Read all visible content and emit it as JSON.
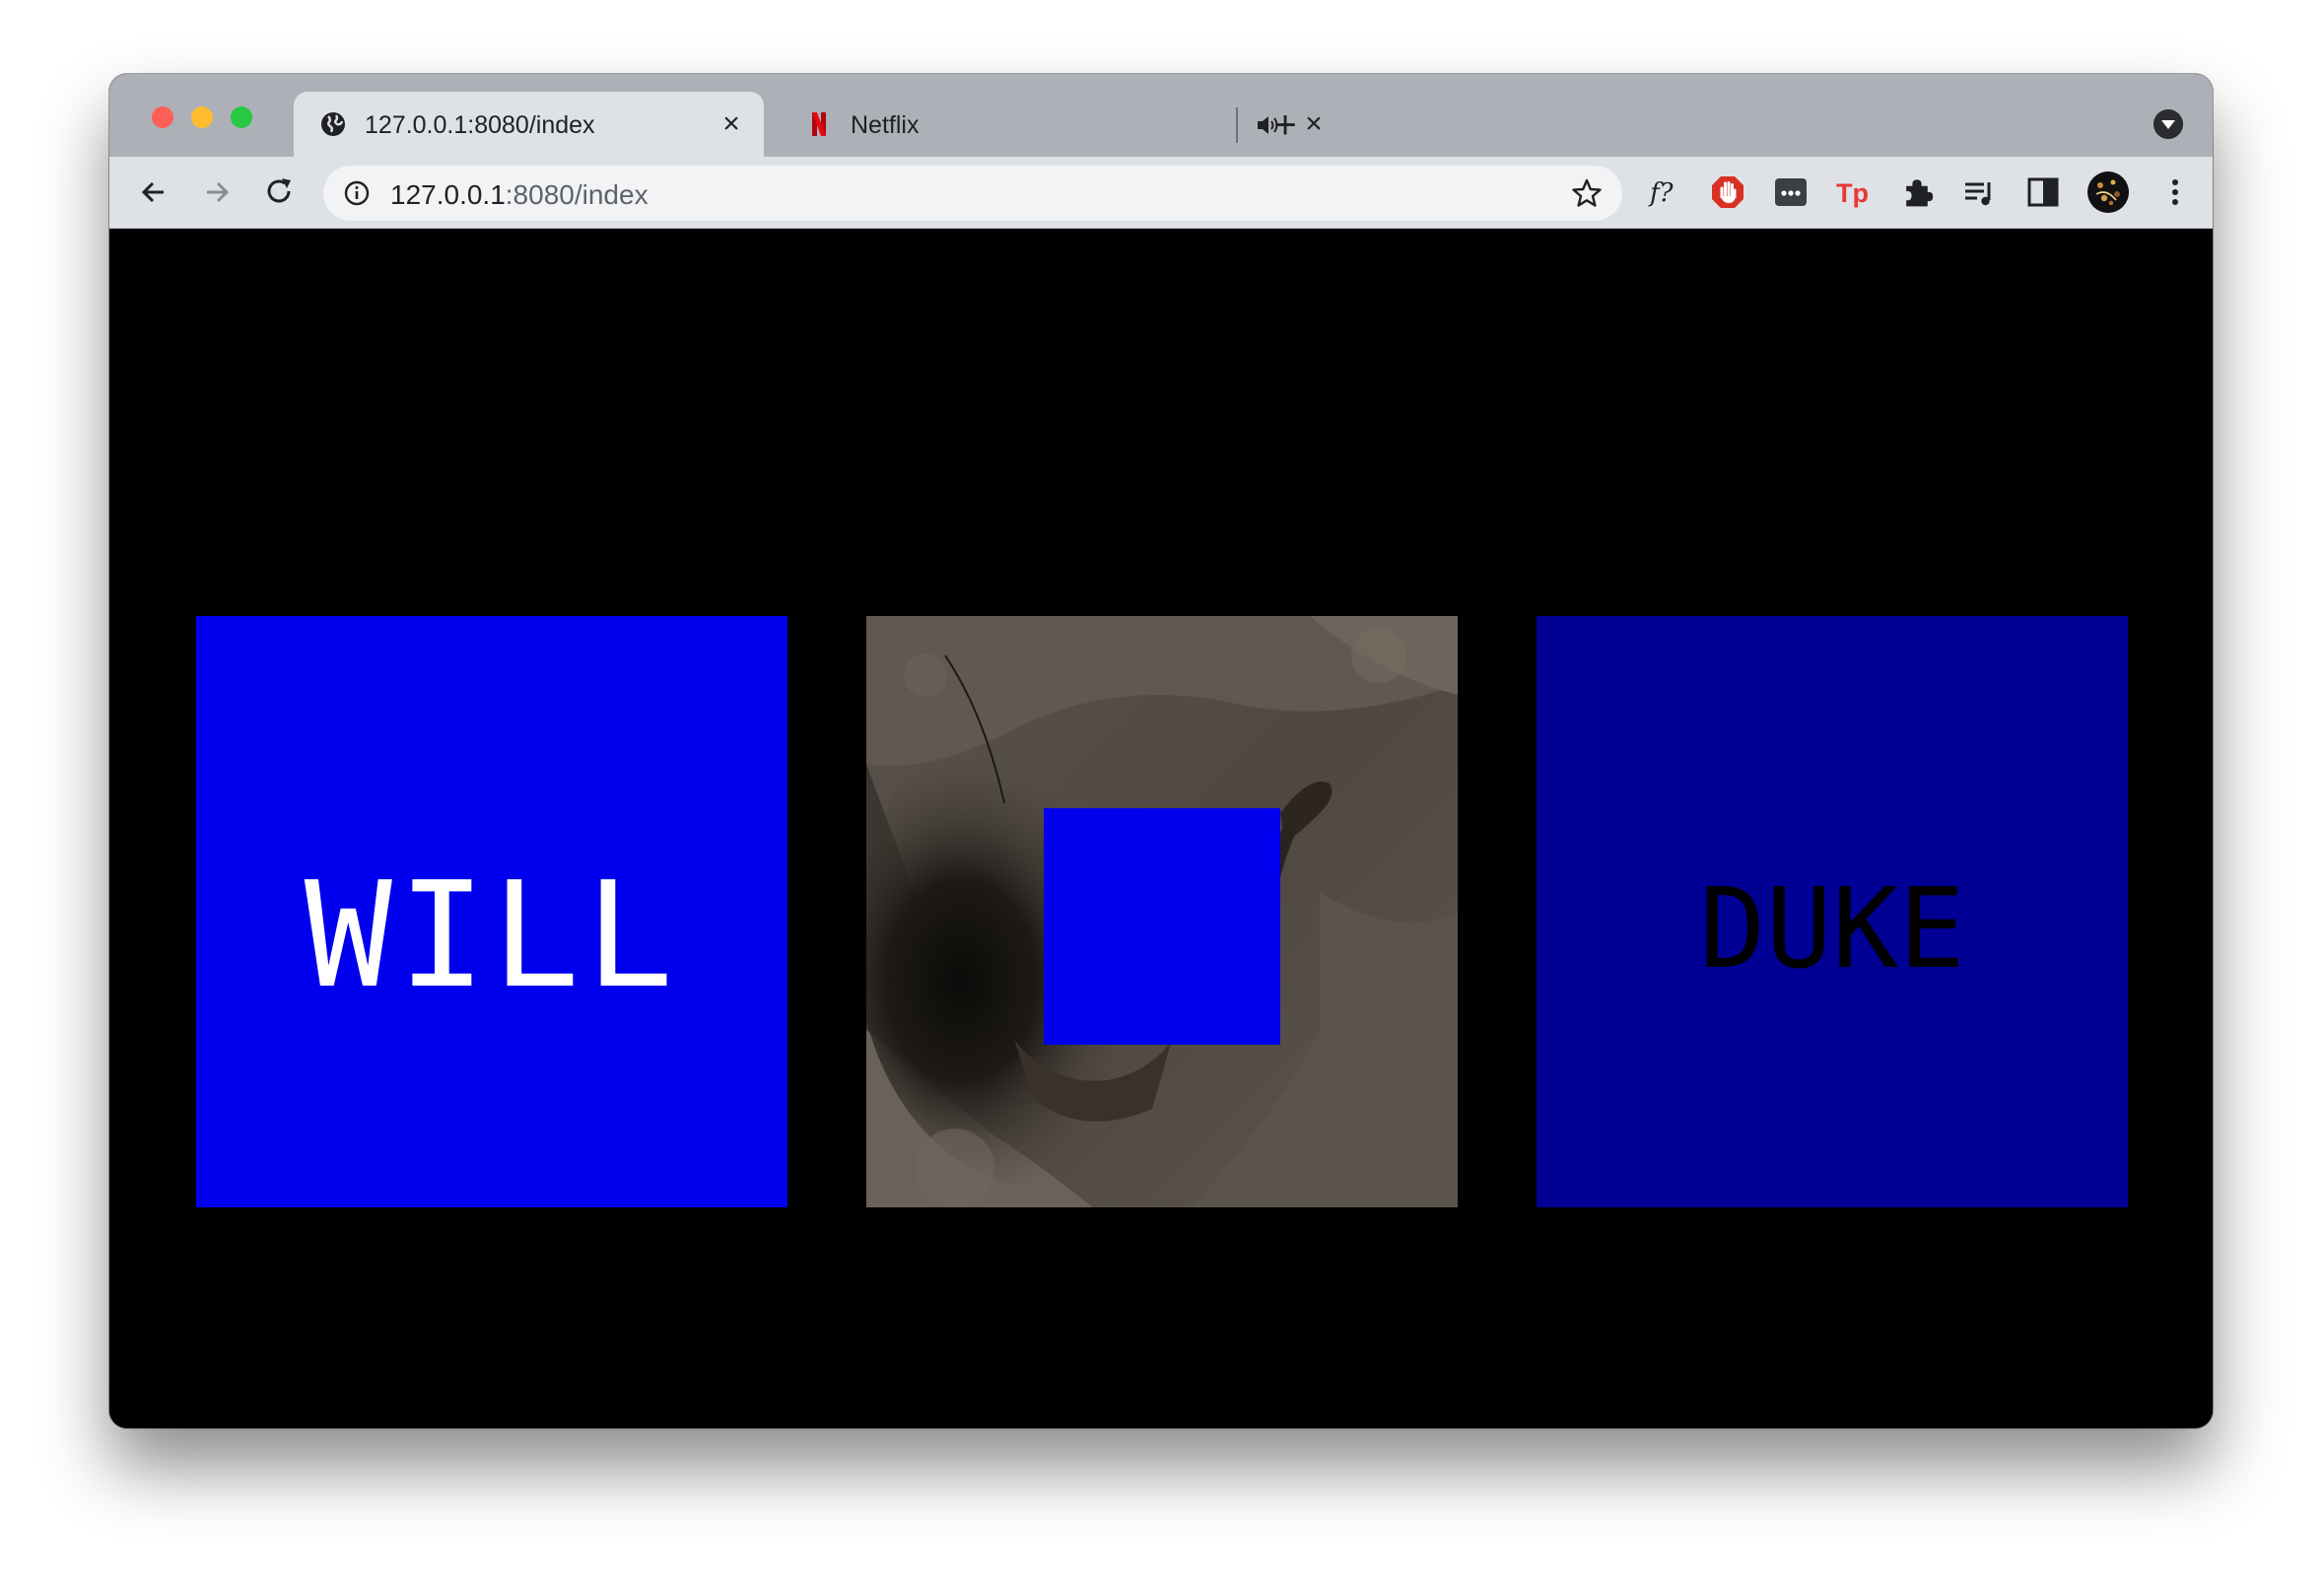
{
  "window": {
    "traffic_lights": [
      "close",
      "minimize",
      "zoom"
    ]
  },
  "tabs": [
    {
      "title": "127.0.0.1:8080/index",
      "favicon": "globe-icon",
      "active": true,
      "close_icon": "close-icon"
    },
    {
      "title": "Netflix",
      "favicon": "netflix-icon",
      "active": false,
      "audio_icon": "speaker-icon",
      "close_icon": "close-icon"
    }
  ],
  "tabstrip": {
    "new_tab_icon": "plus-icon",
    "tab_search_icon": "chevron-down-icon"
  },
  "toolbar": {
    "back_icon": "back-arrow-icon",
    "forward_icon": "forward-arrow-icon",
    "reload_icon": "reload-icon",
    "omnibox": {
      "info_icon": "info-icon",
      "url_host": "127.0.0.1",
      "url_rest": ":8080/index",
      "bookmark_icon": "star-icon"
    },
    "extensions": [
      {
        "name": "font-identifier",
        "label": "f?"
      },
      {
        "name": "adblock",
        "icon": "hand-stop-icon"
      },
      {
        "name": "dots-extension",
        "icon": "ellipsis-box-icon"
      },
      {
        "name": "tp-extension",
        "label": "Tp"
      },
      {
        "name": "extensions-menu",
        "icon": "puzzle-icon"
      },
      {
        "name": "media-controls",
        "icon": "playlist-icon"
      },
      {
        "name": "side-panel",
        "icon": "side-panel-icon"
      },
      {
        "name": "profile",
        "icon": "avatar-icon"
      },
      {
        "name": "chrome-menu",
        "icon": "kebab-menu-icon"
      }
    ]
  },
  "page": {
    "background": "#000000",
    "tiles": [
      {
        "word": "WILL",
        "background": "#0000ee",
        "text_color": "#ffffff"
      },
      {
        "image": "dirt-pit-photo",
        "overlay_color": "#0000ee"
      },
      {
        "word": "DUKE",
        "background": "#000094",
        "text_color": "#000000"
      }
    ]
  }
}
